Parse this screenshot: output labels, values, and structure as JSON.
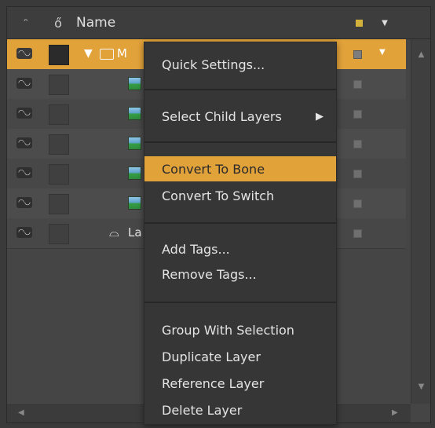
{
  "header": {
    "eye_glyph": "ᵔ",
    "lock_glyph": "ő",
    "name_label": "Name",
    "colorsq_color": "#d3b23c",
    "drop_glyph": "▼"
  },
  "rows": [
    {
      "type": "folder",
      "selected": true,
      "label": "M",
      "drop": "▼"
    },
    {
      "type": "image"
    },
    {
      "type": "image"
    },
    {
      "type": "image"
    },
    {
      "type": "image"
    },
    {
      "type": "image"
    },
    {
      "type": "mesh",
      "label": "La"
    }
  ],
  "eye_text": "◠◡",
  "scroll": {
    "up": "▲",
    "down": "▼",
    "left": "◀",
    "right": "▶"
  },
  "menu": {
    "quick_settings": "Quick Settings...",
    "select_child_layers": "Select Child Layers",
    "submenu_arrow": "▶",
    "convert_to_bone": "Convert To Bone",
    "convert_to_switch": "Convert To Switch",
    "add_tags": "Add Tags...",
    "remove_tags": "Remove Tags...",
    "group_with_selection": "Group With Selection",
    "duplicate_layer": "Duplicate Layer",
    "reference_layer": "Reference Layer",
    "delete_layer": "Delete Layer"
  },
  "colors": {
    "accent": "#e2a23a",
    "panel": "#454545",
    "menu_bg": "#363636"
  }
}
